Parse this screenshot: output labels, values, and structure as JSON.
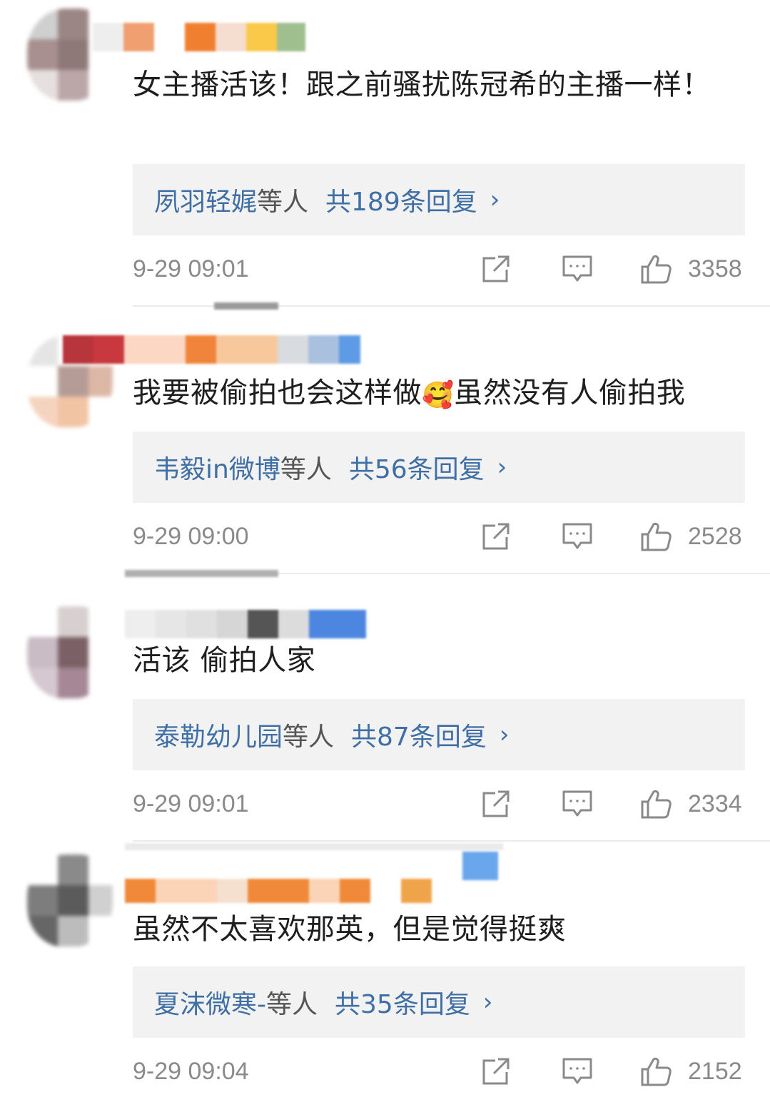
{
  "comments": [
    {
      "text": "女主播活该！跟之前骚扰陈冠希的主播一样！",
      "replies": {
        "names": "夙羽轻娓",
        "suffix": "等人",
        "count_text": "共189条回复"
      },
      "timestamp": "9-29 09:01",
      "likes": "3358",
      "name_colors": [
        "#f0a070",
        "#ffffff",
        "#f08030",
        "#f5ddd0",
        "#fbc94a",
        "#9fbf8f"
      ],
      "avatar_colors": [
        "#cfcfcf",
        "#9b8585",
        "#8e7878",
        "#a99090",
        "#e6dfdf",
        "#bba7a7"
      ]
    },
    {
      "text_before": "我要被偷拍也会这样做",
      "emoji": "🥰",
      "text_after": "虽然没有人偷拍我",
      "replies": {
        "names": "韦毅in微博",
        "suffix": "等人",
        "count_text": "共56条回复"
      },
      "timestamp": "9-29 09:00",
      "likes": "2528",
      "name_colors": [
        "#b8353b",
        "#fbd7c4",
        "#f0843a",
        "#f7c89c",
        "#a9c0df",
        "#5e9be6"
      ],
      "avatar_colors": [
        "#e5e5e5",
        "#b59c96",
        "#f1c4a4",
        "#ffffff",
        "#dcb7a6",
        "#f5d4bf"
      ]
    },
    {
      "text": "活该 偷拍人家",
      "replies": {
        "names": "泰勒幼儿园",
        "suffix": "等人",
        "count_text": "共87条回复"
      },
      "timestamp": "9-29 09:01",
      "likes": "2334",
      "name_colors": [
        "#eeeeee",
        "#e6e6e6",
        "#d6d6d6",
        "#555555",
        "#dcdcdc",
        "#4c86e0"
      ],
      "avatar_colors": [
        "#d8d0d0",
        "#7b6166",
        "#a58795",
        "#c9bcc4",
        "#d5c8d0",
        "#ffffff"
      ]
    },
    {
      "text": "虽然不太喜欢那英，但是觉得挺爽",
      "replies": {
        "names": "夏沫微寒-",
        "suffix": "等人",
        "count_text": "共35条回复"
      },
      "timestamp": "9-29 09:04",
      "likes": "2152",
      "name_colors": [
        "#f08a3a",
        "#fbd4b8",
        "#f08a3a",
        "#fbd4b8",
        "#f08a3a",
        "#f0a44a"
      ],
      "avatar_colors": [
        "#8a8a8a",
        "#5b5b5b",
        "#bcbcbc",
        "#7d7d7d",
        "#d0d0d0",
        "#666666"
      ]
    }
  ],
  "icons": {
    "share": "share-icon",
    "comment": "comment-icon",
    "like": "thumbs-up-icon"
  }
}
